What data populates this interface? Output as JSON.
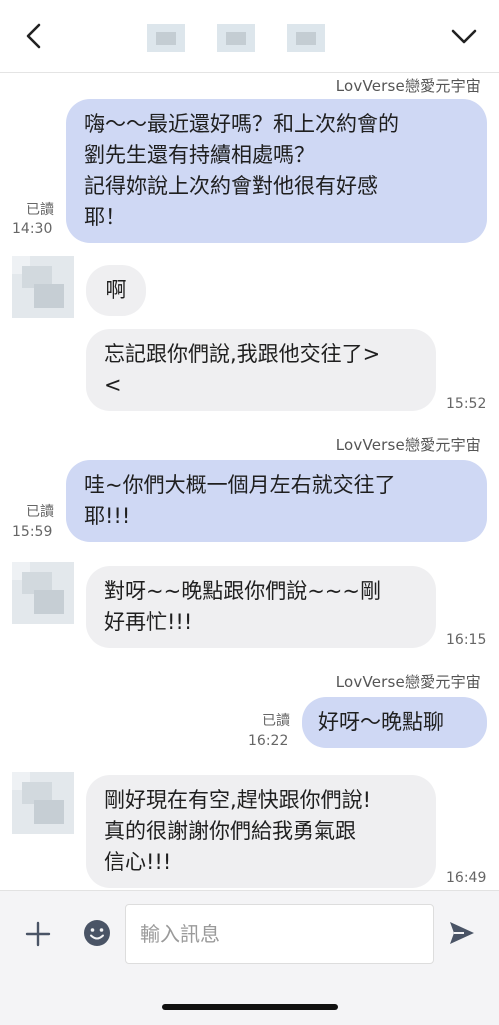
{
  "header": {
    "back_icon": "chevron-left-icon",
    "menu_icon": "chevron-down-icon"
  },
  "messages": [
    {
      "side": "me",
      "sender": "LovVerse戀愛元宇宙",
      "lines": [
        "嗨～～最近還好嗎？和上次約會的",
        "劉先生還有持續相處嗎？",
        "記得妳說上次約會對他很有好感",
        "耶！"
      ],
      "read": "已讀",
      "time": "14:30"
    },
    {
      "side": "them",
      "lines": [
        "啊"
      ]
    },
    {
      "side": "them",
      "lines": [
        "忘記跟你們說,我跟他交往了>",
        "<"
      ],
      "time": "15:52"
    },
    {
      "side": "me",
      "sender": "LovVerse戀愛元宇宙",
      "lines": [
        "哇~你們大概一個月左右就交往了",
        "耶!!!"
      ],
      "read": "已讀",
      "time": "15:59"
    },
    {
      "side": "them",
      "lines": [
        "對呀~~晚點跟你們說~~~剛",
        "好再忙!!!"
      ],
      "time": "16:15"
    },
    {
      "side": "me",
      "sender": "LovVerse戀愛元宇宙",
      "lines": [
        "好呀～晚點聊"
      ],
      "read": "已讀",
      "time": "16:22"
    },
    {
      "side": "them",
      "lines": [
        "剛好現在有空,趕快跟你們說!",
        "真的很謝謝你們給我勇氣跟",
        "信心!!!"
      ],
      "time": "16:49"
    }
  ],
  "input": {
    "placeholder": "輸入訊息",
    "value": ""
  },
  "colors": {
    "my_bubble": "#cfd8f4",
    "their_bubble": "#efeff1",
    "input_bar": "#f4f4f6"
  }
}
